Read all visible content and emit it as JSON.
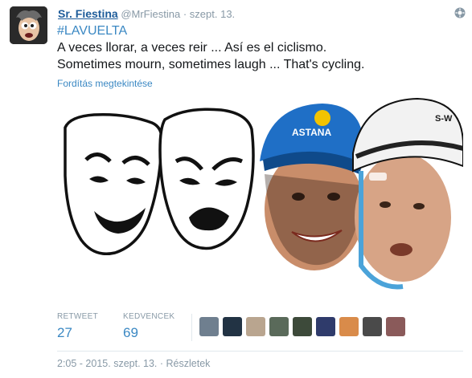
{
  "tweet": {
    "display_name": "Sr. Fiestina",
    "handle": "@MrFiestina",
    "separator": "·",
    "date": "szept. 13.",
    "hashtag": "#LAVUELTA",
    "line1": "A veces llorar, a veces reir ... Así es el ciclismo.",
    "line2": "Sometimes mourn, sometimes laugh ... That's cycling.",
    "translate_link": "Fordítás megtekintése"
  },
  "stats": {
    "retweet_label": "RETWEET",
    "retweet_count": "27",
    "favorites_label": "KEDVENCEK",
    "favorites_count": "69"
  },
  "footer": {
    "timestamp": "2:05 - 2015. szept. 13.",
    "separator": "·",
    "details_link": "Részletek"
  },
  "icons": {
    "gear": "gear-icon",
    "avatar": "avatar"
  },
  "colors": {
    "link": "#3b88c3",
    "name": "#1e5c9a",
    "muted": "#8899a6",
    "helmet_blue": "#1f6fc6"
  }
}
